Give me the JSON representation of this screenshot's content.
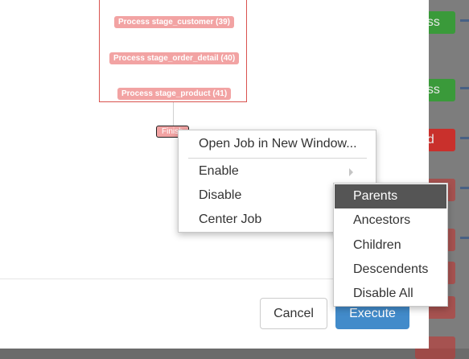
{
  "background": {
    "badges": [
      {
        "text": "ess",
        "color": "#3a9a3a"
      },
      {
        "text": "ess",
        "color": "#3a9a3a"
      },
      {
        "text": "ed",
        "color": "#c9302c"
      },
      {
        "text": "",
        "color": "#c9302c"
      },
      {
        "text": "",
        "color": "#c9302c"
      },
      {
        "text": "",
        "color": "#c9302c"
      },
      {
        "text": "",
        "color": "#c9302c"
      },
      {
        "text": "",
        "color": "#c9302c"
      }
    ]
  },
  "graph": {
    "nodes": [
      {
        "label": "Process stage_customer (39)"
      },
      {
        "label": "Process stage_order_detail (40)"
      },
      {
        "label": "Process stage_product (41)"
      }
    ],
    "finish_label": "Finish"
  },
  "footer": {
    "cancel_label": "Cancel",
    "execute_label": "Execute"
  },
  "context_menu": {
    "open_job_label": "Open Job in New Window...",
    "enable_label": "Enable",
    "disable_label": "Disable",
    "center_job_label": "Center Job"
  },
  "submenu": {
    "items": [
      "Parents",
      "Ancestors",
      "Children",
      "Descendents",
      "Disable All"
    ],
    "active": "Parents"
  },
  "colors": {
    "node_fill": "#f2a3a3",
    "group_border": "#d9534f",
    "execute_button": "#428bca",
    "submenu_active": "#555555"
  }
}
